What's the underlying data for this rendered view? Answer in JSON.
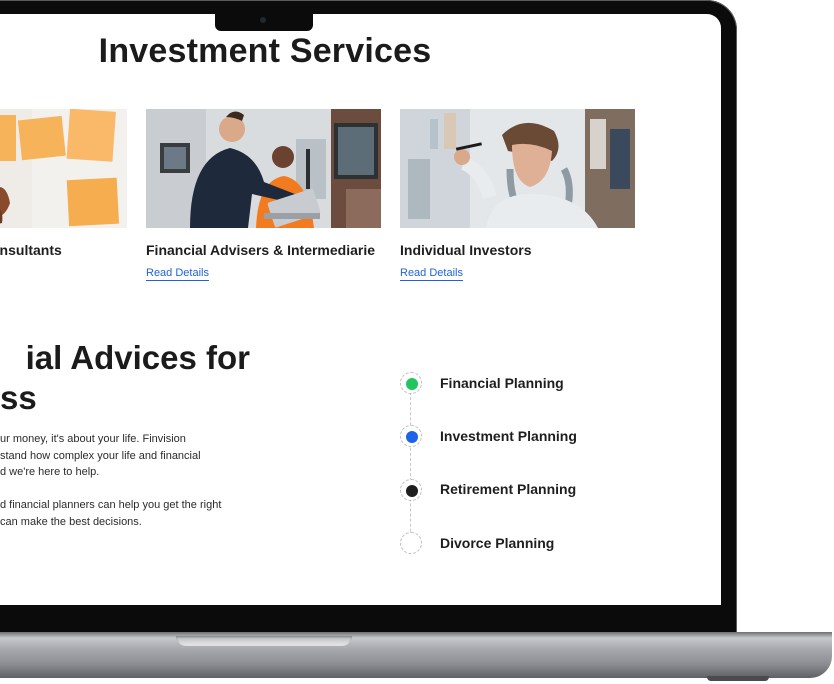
{
  "page": {
    "heading": "Investment Services"
  },
  "cards": [
    {
      "title": "onsultants",
      "link": ""
    },
    {
      "title": "Financial Advisers & Intermediarie",
      "link": "Read Details"
    },
    {
      "title": "Individual Investors",
      "link": "Read Details"
    }
  ],
  "advice": {
    "title_line1": "ial Advices for",
    "title_line2": "ss",
    "p1_line1": "ur money, it's about your life. Finvision",
    "p1_line2": "stand how complex your life and financial",
    "p1_line3": "d we're here to help.",
    "p2_line1": "d financial planners can help you get the right",
    "p2_line2": "can make the best decisions."
  },
  "timeline": [
    {
      "label": "Financial Planning",
      "color": "#22c55e"
    },
    {
      "label": "Investment Planning",
      "color": "#1f63e8"
    },
    {
      "label": "Retirement Planning",
      "color": "#1e1e1e"
    },
    {
      "label": "Divorce Planning",
      "color": ""
    }
  ]
}
